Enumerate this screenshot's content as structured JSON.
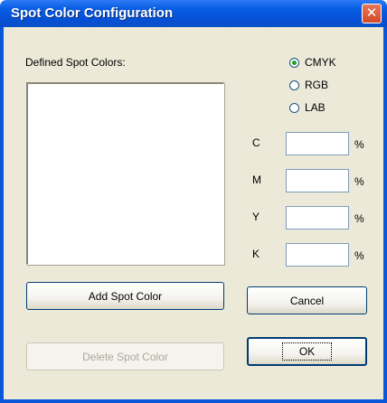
{
  "window": {
    "title": "Spot Color Configuration",
    "close_glyph": "✕"
  },
  "list": {
    "label": "Defined Spot Colors:"
  },
  "color_mode": {
    "options": [
      {
        "label": "CMYK",
        "checked": true
      },
      {
        "label": "RGB",
        "checked": false
      },
      {
        "label": "LAB",
        "checked": false
      }
    ]
  },
  "fields": [
    {
      "label": "C",
      "value": "",
      "unit": "%"
    },
    {
      "label": "M",
      "value": "",
      "unit": "%"
    },
    {
      "label": "Y",
      "value": "",
      "unit": "%"
    },
    {
      "label": "K",
      "value": "",
      "unit": "%"
    }
  ],
  "buttons": {
    "add": "Add Spot Color",
    "delete": "Delete Spot Color",
    "cancel": "Cancel",
    "ok": "OK"
  },
  "colors": {
    "titlebar": "#0a56d8",
    "face": "#ece9d8",
    "close": "#d24a26"
  }
}
